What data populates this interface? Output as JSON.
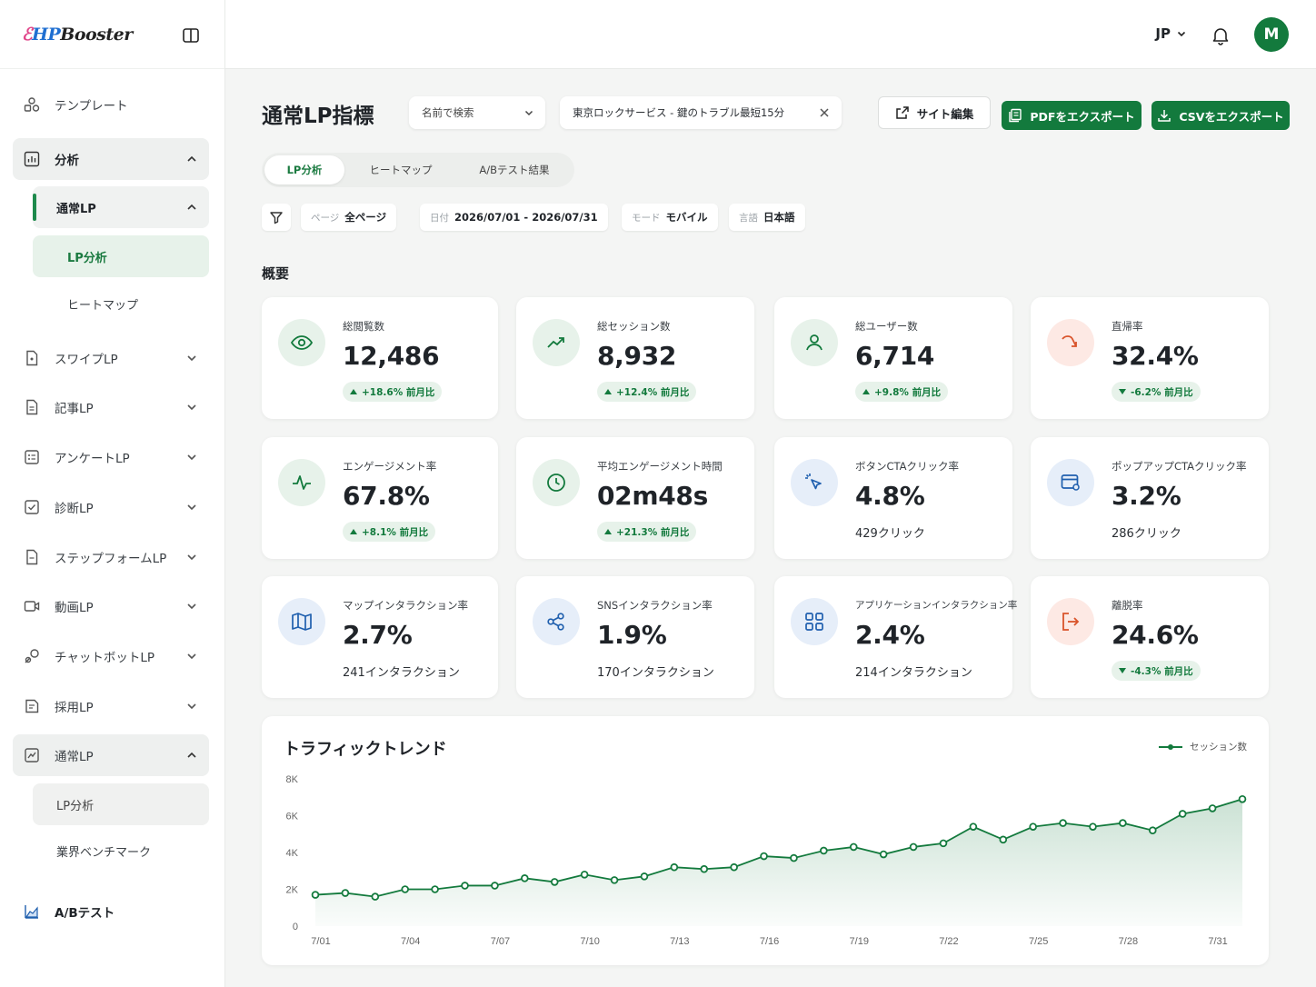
{
  "app": {
    "logo_text": "HPBooster"
  },
  "sidebar": {
    "template": "テンプレート",
    "analysis": "分析",
    "analysis_sub": {
      "label": "通常LP",
      "items": [
        "LP分析",
        "ヒートマップ"
      ]
    },
    "menu": [
      "スワイプLP",
      "記事LP",
      "アンケートLP",
      "診断LP",
      "ステップフォームLP",
      "動画LP",
      "チャットボットLP",
      "採用LP"
    ],
    "normal_lp": {
      "label": "通常LP",
      "items": [
        "LP分析",
        "業界ベンチマーク"
      ]
    },
    "ab_test": "A/Bテスト"
  },
  "topbar": {
    "language": "JP",
    "avatar_initial": "M"
  },
  "header": {
    "title": "通常LP指標",
    "search_select": "名前で検索",
    "selected_page": "東京ロックサービス - 鍵のトラブル最短15分",
    "edit_site": "サイト編集",
    "export_pdf": "PDFをエクスポート",
    "export_csv": "CSVをエクスポート"
  },
  "tabs": [
    "LP分析",
    "ヒートマップ",
    "A/Bテスト結果"
  ],
  "filters": [
    {
      "key": "ページ",
      "value": "全ページ"
    },
    {
      "key": "日付",
      "value": "2026/07/01 - 2026/07/31"
    },
    {
      "key": "モード",
      "value": "モバイル"
    },
    {
      "key": "言語",
      "value": "日本語"
    }
  ],
  "overview_title": "概要",
  "metrics": [
    {
      "label": "総閲覧数",
      "value": "12,486",
      "delta": "+18.6% 前月比",
      "trend": "up",
      "icon": "eye-icon",
      "tone": "green"
    },
    {
      "label": "総セッション数",
      "value": "8,932",
      "delta": "+12.4% 前月比",
      "trend": "up",
      "icon": "trending-up-icon",
      "tone": "green"
    },
    {
      "label": "総ユーザー数",
      "value": "6,714",
      "delta": "+9.8% 前月比",
      "trend": "up",
      "icon": "user-icon",
      "tone": "green"
    },
    {
      "label": "直帰率",
      "value": "32.4%",
      "delta": "-6.2% 前月比",
      "trend": "down",
      "icon": "bounce-icon",
      "tone": "red"
    },
    {
      "label": "エンゲージメント率",
      "value": "67.8%",
      "delta": "+8.1% 前月比",
      "trend": "up",
      "icon": "activity-icon",
      "tone": "green"
    },
    {
      "label": "平均エンゲージメント時間",
      "value": "02m48s",
      "delta": "+21.3% 前月比",
      "trend": "up",
      "icon": "clock-icon",
      "tone": "green"
    },
    {
      "label": "ボタンCTAクリック率",
      "value": "4.8%",
      "sub": "429クリック",
      "icon": "cursor-click-icon",
      "tone": "blue"
    },
    {
      "label": "ポップアップCTAクリック率",
      "value": "3.2%",
      "sub": "286クリック",
      "icon": "popup-window-icon",
      "tone": "blue"
    },
    {
      "label": "マップインタラクション率",
      "value": "2.7%",
      "sub": "241インタラクション",
      "icon": "map-icon",
      "tone": "blue"
    },
    {
      "label": "SNSインタラクション率",
      "value": "1.9%",
      "sub": "170インタラクション",
      "icon": "share-icon",
      "tone": "blue"
    },
    {
      "label": "アプリケーションインタラクション率",
      "value": "2.4%",
      "sub": "214インタラクション",
      "icon": "apps-grid-icon",
      "tone": "blue"
    },
    {
      "label": "離脱率",
      "value": "24.6%",
      "delta": "-4.3% 前月比",
      "trend": "down",
      "icon": "exit-icon",
      "tone": "red"
    }
  ],
  "colors": {
    "accent": "#137a3d",
    "accent_light": "#e7f2ea",
    "blue_icon": "#1f5fae",
    "red_icon": "#d9542b"
  },
  "chart_data": {
    "type": "area",
    "title": "トラフィックトレンド",
    "series": [
      {
        "name": "セッション数",
        "values": [
          1700,
          1800,
          1600,
          2000,
          2000,
          2200,
          2200,
          2600,
          2400,
          2800,
          2500,
          2700,
          3200,
          3100,
          3200,
          3800,
          3700,
          4100,
          4300,
          3900,
          4300,
          4500,
          5400,
          4700,
          5400,
          5600,
          5400,
          5600,
          5200,
          6100,
          6400,
          6900
        ]
      }
    ],
    "x_tick_labels": [
      "7/01",
      "7/04",
      "7/07",
      "7/10",
      "7/13",
      "7/16",
      "7/19",
      "7/22",
      "7/25",
      "7/28",
      "7/31"
    ],
    "y_tick_labels": [
      "0",
      "2K",
      "4K",
      "6K",
      "8K"
    ],
    "ylim": [
      0,
      8000
    ],
    "grid": false,
    "legend": "top-right"
  }
}
